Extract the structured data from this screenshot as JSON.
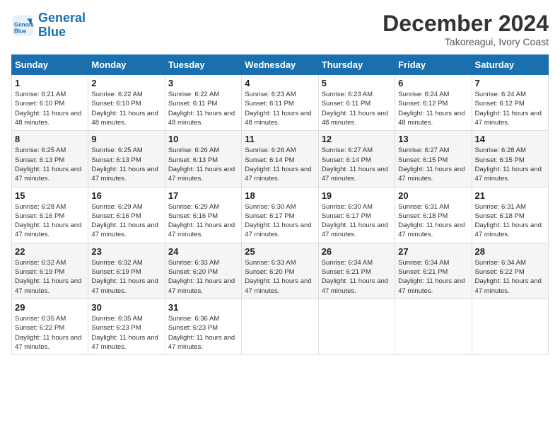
{
  "header": {
    "logo_line1": "General",
    "logo_line2": "Blue",
    "month": "December 2024",
    "location": "Takoreagui, Ivory Coast"
  },
  "weekdays": [
    "Sunday",
    "Monday",
    "Tuesday",
    "Wednesday",
    "Thursday",
    "Friday",
    "Saturday"
  ],
  "weeks": [
    [
      {
        "day": "1",
        "sunrise": "6:21 AM",
        "sunset": "6:10 PM",
        "daylight": "11 hours and 48 minutes."
      },
      {
        "day": "2",
        "sunrise": "6:22 AM",
        "sunset": "6:10 PM",
        "daylight": "11 hours and 48 minutes."
      },
      {
        "day": "3",
        "sunrise": "6:22 AM",
        "sunset": "6:11 PM",
        "daylight": "11 hours and 48 minutes."
      },
      {
        "day": "4",
        "sunrise": "6:23 AM",
        "sunset": "6:11 PM",
        "daylight": "11 hours and 48 minutes."
      },
      {
        "day": "5",
        "sunrise": "6:23 AM",
        "sunset": "6:11 PM",
        "daylight": "11 hours and 48 minutes."
      },
      {
        "day": "6",
        "sunrise": "6:24 AM",
        "sunset": "6:12 PM",
        "daylight": "11 hours and 48 minutes."
      },
      {
        "day": "7",
        "sunrise": "6:24 AM",
        "sunset": "6:12 PM",
        "daylight": "11 hours and 47 minutes."
      }
    ],
    [
      {
        "day": "8",
        "sunrise": "6:25 AM",
        "sunset": "6:13 PM",
        "daylight": "11 hours and 47 minutes."
      },
      {
        "day": "9",
        "sunrise": "6:25 AM",
        "sunset": "6:13 PM",
        "daylight": "11 hours and 47 minutes."
      },
      {
        "day": "10",
        "sunrise": "6:26 AM",
        "sunset": "6:13 PM",
        "daylight": "11 hours and 47 minutes."
      },
      {
        "day": "11",
        "sunrise": "6:26 AM",
        "sunset": "6:14 PM",
        "daylight": "11 hours and 47 minutes."
      },
      {
        "day": "12",
        "sunrise": "6:27 AM",
        "sunset": "6:14 PM",
        "daylight": "11 hours and 47 minutes."
      },
      {
        "day": "13",
        "sunrise": "6:27 AM",
        "sunset": "6:15 PM",
        "daylight": "11 hours and 47 minutes."
      },
      {
        "day": "14",
        "sunrise": "6:28 AM",
        "sunset": "6:15 PM",
        "daylight": "11 hours and 47 minutes."
      }
    ],
    [
      {
        "day": "15",
        "sunrise": "6:28 AM",
        "sunset": "6:16 PM",
        "daylight": "11 hours and 47 minutes."
      },
      {
        "day": "16",
        "sunrise": "6:29 AM",
        "sunset": "6:16 PM",
        "daylight": "11 hours and 47 minutes."
      },
      {
        "day": "17",
        "sunrise": "6:29 AM",
        "sunset": "6:16 PM",
        "daylight": "11 hours and 47 minutes."
      },
      {
        "day": "18",
        "sunrise": "6:30 AM",
        "sunset": "6:17 PM",
        "daylight": "11 hours and 47 minutes."
      },
      {
        "day": "19",
        "sunrise": "6:30 AM",
        "sunset": "6:17 PM",
        "daylight": "11 hours and 47 minutes."
      },
      {
        "day": "20",
        "sunrise": "6:31 AM",
        "sunset": "6:18 PM",
        "daylight": "11 hours and 47 minutes."
      },
      {
        "day": "21",
        "sunrise": "6:31 AM",
        "sunset": "6:18 PM",
        "daylight": "11 hours and 47 minutes."
      }
    ],
    [
      {
        "day": "22",
        "sunrise": "6:32 AM",
        "sunset": "6:19 PM",
        "daylight": "11 hours and 47 minutes."
      },
      {
        "day": "23",
        "sunrise": "6:32 AM",
        "sunset": "6:19 PM",
        "daylight": "11 hours and 47 minutes."
      },
      {
        "day": "24",
        "sunrise": "6:33 AM",
        "sunset": "6:20 PM",
        "daylight": "11 hours and 47 minutes."
      },
      {
        "day": "25",
        "sunrise": "6:33 AM",
        "sunset": "6:20 PM",
        "daylight": "11 hours and 47 minutes."
      },
      {
        "day": "26",
        "sunrise": "6:34 AM",
        "sunset": "6:21 PM",
        "daylight": "11 hours and 47 minutes."
      },
      {
        "day": "27",
        "sunrise": "6:34 AM",
        "sunset": "6:21 PM",
        "daylight": "11 hours and 47 minutes."
      },
      {
        "day": "28",
        "sunrise": "6:34 AM",
        "sunset": "6:22 PM",
        "daylight": "11 hours and 47 minutes."
      }
    ],
    [
      {
        "day": "29",
        "sunrise": "6:35 AM",
        "sunset": "6:22 PM",
        "daylight": "11 hours and 47 minutes."
      },
      {
        "day": "30",
        "sunrise": "6:35 AM",
        "sunset": "6:23 PM",
        "daylight": "11 hours and 47 minutes."
      },
      {
        "day": "31",
        "sunrise": "6:36 AM",
        "sunset": "6:23 PM",
        "daylight": "11 hours and 47 minutes."
      },
      null,
      null,
      null,
      null
    ]
  ]
}
